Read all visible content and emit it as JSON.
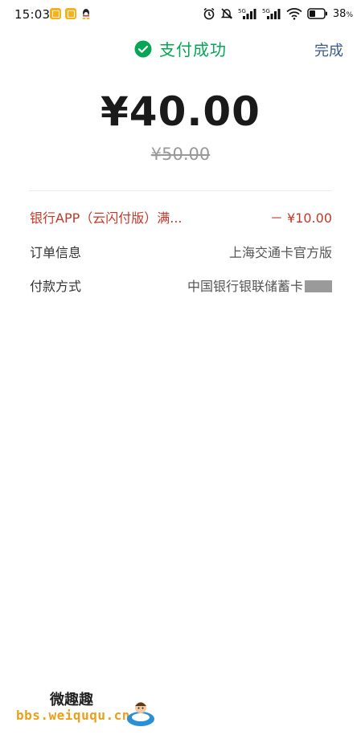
{
  "status_bar": {
    "time": "15:03",
    "battery_percent": "38",
    "battery_unit": "%",
    "signal_label_1": "5G",
    "signal_label_2": "5G",
    "notification_icons": [
      "notes-app-icon",
      "clipboard-app-icon",
      "qq-icon"
    ],
    "system_icons": [
      "alarm-icon",
      "mute-icon",
      "signal-5g-icon",
      "signal-5g-icon",
      "wifi-icon",
      "battery-icon"
    ]
  },
  "header": {
    "title": "支付成功",
    "done_label": "完成",
    "success_color": "#07a656"
  },
  "amount": {
    "paid": "¥40.00",
    "original": "¥50.00"
  },
  "details": {
    "discount": {
      "label": "银行APP（云闪付版）满...",
      "value": "－ ¥10.00"
    },
    "order": {
      "label": "订单信息",
      "value": "上海交通卡官方版"
    },
    "payment": {
      "label": "付款方式",
      "value": "中国银行银联储蓄卡"
    }
  },
  "watermark": {
    "title": "微趣趣",
    "url": "bbs.weiququ.cn"
  }
}
